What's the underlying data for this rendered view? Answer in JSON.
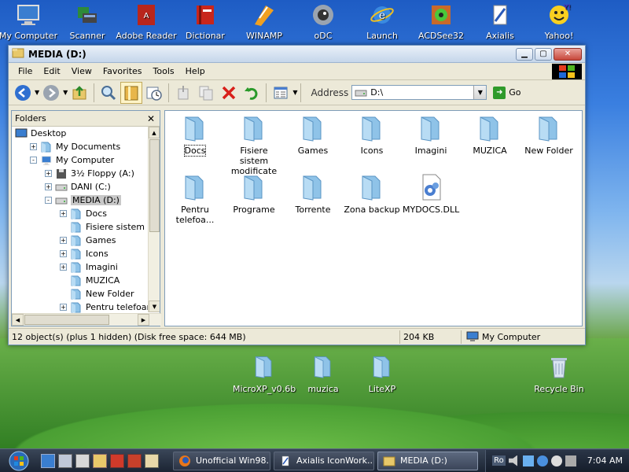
{
  "desktop": {
    "icons": [
      {
        "label": "My Computer",
        "icon": "computer-icon"
      },
      {
        "label": "Scanner",
        "icon": "scanner-icon"
      },
      {
        "label": "Adobe Reader",
        "icon": "adobe-reader-icon"
      },
      {
        "label": "Dictionar",
        "icon": "book-icon"
      },
      {
        "label": "WINAMP",
        "icon": "winamp-icon"
      },
      {
        "label": "oDC",
        "icon": "odc-icon"
      },
      {
        "label": "Launch",
        "icon": "internet-explorer-icon"
      },
      {
        "label": "ACDSee32",
        "icon": "acdsee-icon"
      },
      {
        "label": "Axialis",
        "icon": "axialis-icon"
      },
      {
        "label": "Yahoo!",
        "icon": "yahoo-icon"
      }
    ],
    "bottom_icons": [
      {
        "label": "MicroXP_v0.6b",
        "icon": "folder-icon"
      },
      {
        "label": "muzica",
        "icon": "folder-icon"
      },
      {
        "label": "LiteXP",
        "icon": "folder-icon"
      },
      {
        "label": "Recycle Bin",
        "icon": "recycle-bin-icon"
      }
    ]
  },
  "window": {
    "title": "MEDIA (D:)",
    "menu": [
      "File",
      "Edit",
      "View",
      "Favorites",
      "Tools",
      "Help"
    ],
    "address_label": "Address",
    "address_value": "D:\\",
    "go_label": "Go",
    "folders_title": "Folders",
    "tree": [
      {
        "label": "Desktop",
        "indent": 0,
        "expander": "",
        "icon": "desktop-icon"
      },
      {
        "label": "My Documents",
        "indent": 1,
        "expander": "+",
        "icon": "folder-icon"
      },
      {
        "label": "My Computer",
        "indent": 1,
        "expander": "-",
        "icon": "computer-icon"
      },
      {
        "label": "3½ Floppy (A:)",
        "indent": 2,
        "expander": "+",
        "icon": "floppy-icon"
      },
      {
        "label": "DANI (C:)",
        "indent": 2,
        "expander": "+",
        "icon": "drive-icon"
      },
      {
        "label": "MEDIA (D:)",
        "indent": 2,
        "expander": "-",
        "icon": "drive-icon",
        "selected": true
      },
      {
        "label": "Docs",
        "indent": 3,
        "expander": "+",
        "icon": "folder-icon"
      },
      {
        "label": "Fisiere sistem modif",
        "indent": 3,
        "expander": "",
        "icon": "folder-icon"
      },
      {
        "label": "Games",
        "indent": 3,
        "expander": "+",
        "icon": "folder-icon"
      },
      {
        "label": "Icons",
        "indent": 3,
        "expander": "+",
        "icon": "folder-icon"
      },
      {
        "label": "Imagini",
        "indent": 3,
        "expander": "+",
        "icon": "folder-icon"
      },
      {
        "label": "MUZICA",
        "indent": 3,
        "expander": "",
        "icon": "folder-icon"
      },
      {
        "label": "New Folder",
        "indent": 3,
        "expander": "",
        "icon": "folder-icon"
      },
      {
        "label": "Pentru telefoane m",
        "indent": 3,
        "expander": "+",
        "icon": "folder-icon"
      }
    ],
    "files": [
      {
        "label": "Docs",
        "icon": "folder-icon",
        "focused": true
      },
      {
        "label": "Fisiere sistem modificate",
        "icon": "folder-icon"
      },
      {
        "label": "Games",
        "icon": "folder-icon"
      },
      {
        "label": "Icons",
        "icon": "folder-icon"
      },
      {
        "label": "Imagini",
        "icon": "folder-icon"
      },
      {
        "label": "MUZICA",
        "icon": "folder-icon"
      },
      {
        "label": "New Folder",
        "icon": "folder-icon"
      },
      {
        "label": "Pentru telefoa...",
        "icon": "folder-icon"
      },
      {
        "label": "Programe",
        "icon": "folder-icon"
      },
      {
        "label": "Torrente",
        "icon": "folder-icon"
      },
      {
        "label": "Zona backup",
        "icon": "folder-icon"
      },
      {
        "label": "MYDOCS.DLL",
        "icon": "dll-file-icon"
      }
    ],
    "status": {
      "objects": "12 object(s) (plus 1 hidden) (Disk free space: 644 MB)",
      "size": "204 KB",
      "zone": "My Computer"
    }
  },
  "taskbar": {
    "tasks": [
      {
        "label": "Unofficial Win98...",
        "icon": "firefox-icon"
      },
      {
        "label": "Axialis IconWork...",
        "icon": "axialis-icon"
      },
      {
        "label": "MEDIA (D:)",
        "icon": "folder-icon",
        "active": true
      }
    ],
    "language": "Ro",
    "clock": "7:04 AM"
  },
  "colors": {
    "folder": "#8fc3e8",
    "selection": "#c8c8c8",
    "titlebar": "#c5d6ea"
  }
}
